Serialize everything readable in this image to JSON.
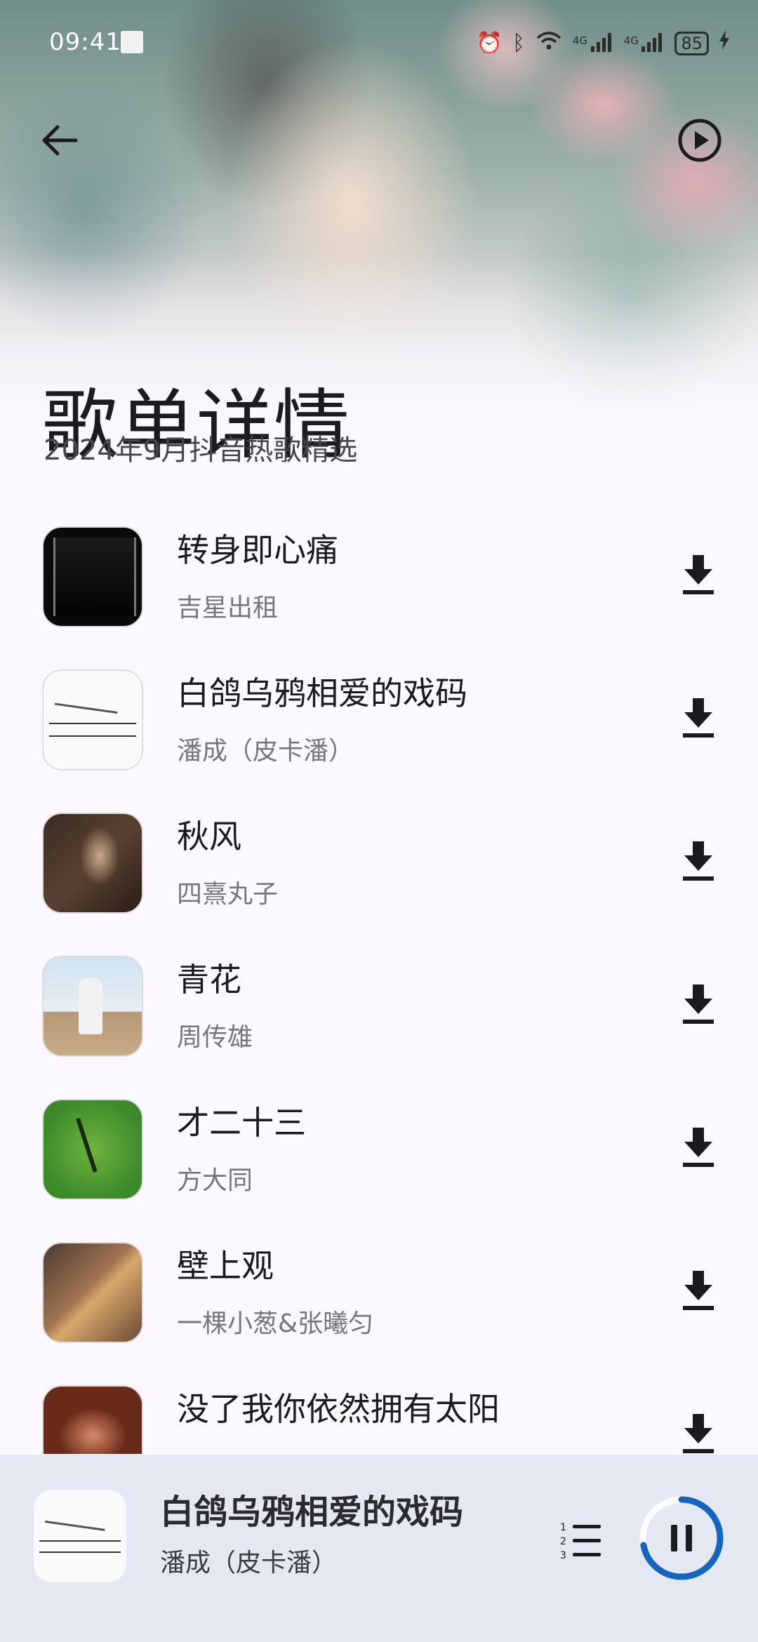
{
  "status_bar": {
    "time": "09:41",
    "network_1": "4G",
    "network_2": "4G",
    "battery": "85"
  },
  "header": {
    "title": "歌单详情",
    "subtitle": "2024年9月抖音热歌精选"
  },
  "songs": [
    {
      "title": "转身即心痛",
      "artist": "吉星出租"
    },
    {
      "title": "白鸽乌鸦相爱的戏码",
      "artist": "潘成（皮卡潘）"
    },
    {
      "title": "秋风",
      "artist": "四熹丸子"
    },
    {
      "title": "青花",
      "artist": "周传雄"
    },
    {
      "title": "才二十三",
      "artist": "方大同"
    },
    {
      "title": "壁上观",
      "artist": "一棵小葱&张曦匀"
    },
    {
      "title": "没了我你依然拥有太阳",
      "artist": ""
    }
  ],
  "player": {
    "title": "白鸽乌鸦相爱的戏码",
    "artist": "潘成（皮卡潘）",
    "state": "playing",
    "progress": 0.72
  },
  "icons": {
    "back": "arrow-left-icon",
    "play_all": "play-circle-icon",
    "download": "download-icon",
    "queue": "numbered-list-icon",
    "pause": "pause-icon"
  },
  "colors": {
    "accent": "#1565c0",
    "player_bg": "#e4e8f3",
    "text_primary": "#1b1b1f",
    "text_secondary": "#77767e"
  }
}
